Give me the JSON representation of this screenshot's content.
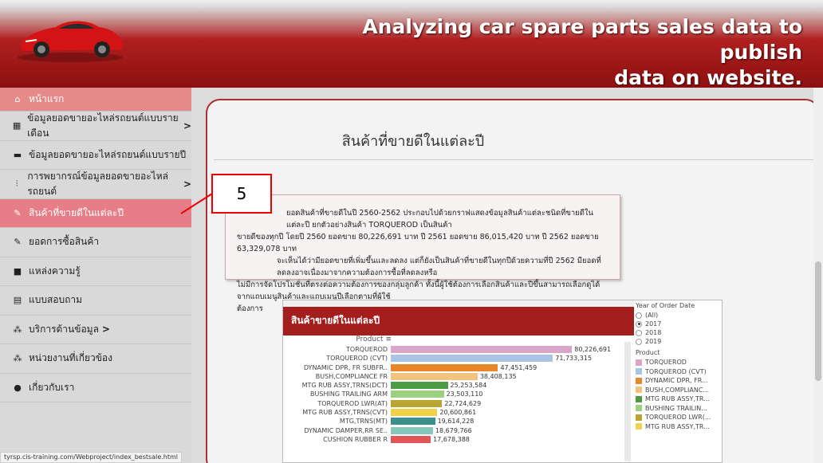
{
  "header": {
    "title_line1": "Analyzing car spare parts sales data to publish",
    "title_line2": "data on website."
  },
  "sidebar": {
    "items": [
      {
        "label": "หน้าแรก",
        "icon": "home-icon"
      },
      {
        "label": "ข้อมูลยอดขายอะไหล่รถยนต์แบบรายเดือน",
        "icon": "calendar-icon",
        "arrow": ">"
      },
      {
        "label": "ข้อมูลยอดขายอะไหล่รถยนต์แบบรายปี",
        "icon": "calendar-icon"
      },
      {
        "label": "การพยากรณ์ข้อมูลยอดขายอะไหล่รถยนต์",
        "icon": "chart-icon",
        "arrow": ">"
      },
      {
        "label": "สินค้าที่ขายดีในแต่ละปี",
        "icon": "wrench-icon"
      },
      {
        "label": "ยอดการซื้อสินค้า",
        "icon": "wrench-icon"
      },
      {
        "label": "แหล่งความรู้",
        "icon": "book-icon"
      },
      {
        "label": "แบบสอบถาม",
        "icon": "document-icon"
      },
      {
        "label": "บริการด้านข้อมูล",
        "icon": "sitemap-icon",
        "arrow": ">"
      },
      {
        "label": "หน่วยงานที่เกี่ยวข้อง",
        "icon": "sitemap-icon"
      },
      {
        "label": "เกี่ยวกับเรา",
        "icon": "user-icon"
      }
    ]
  },
  "main": {
    "title": "สินค้าที่ขายดีในแต่ละปี",
    "description_line1": "ยอดสินค้าที่ขายดีในปี 2560-2562 ประกอบไปด้วยกราฟแสดงข้อมูลสินค้าแต่ละชนิดที่ขายดีในแต่ละปี ยกตัวอย่างสินค้า TORQUEROD เป็นสินค้า",
    "description_line2": "ขายดีของทุกปี โดยปี 2560 ยอดขาย 80,226,691 บาท ปี 2561 ยอดขาย 86,015,420 บาท ปี 2562 ยอดขาย 63,329,078 บาท",
    "description_line3": "จะเห็นได้ว่ามียอดขายที่เพิ่มขึ้นและลดลง แต่ก็ยังเป็นสินค้าที่ขายดีในทุกปีด้วยความที่ปี 2562 มียอดที่ลดลงอาจเนื่องมาจากความต้องการซื้อที่ลดลงหรือ",
    "description_line4": "ไม่มีการจัดโปรโมชั่นที่ตรงต่อความต้องการของกลุ่มลูกค้า ทั้งนี้ผู้ใช้ต้องการเลือกสินค้าและปีขึ้นสามารถเลือกดูได้จากแถบเมนูสินค้าและแถบเมนูปีเลือกตามที่ผู้ใช้",
    "description_line5": "ต้องการ",
    "callout_number": "5"
  },
  "status_url": "tyrsp.cis-training.com/Webproject/index_bestsale.html",
  "filters": {
    "year_title": "Year of Order Date",
    "years": [
      "(All)",
      "2017",
      "2018",
      "2019"
    ],
    "selected_year": "2017",
    "product_title": "Product",
    "products": [
      {
        "name": "TORQUEROD",
        "color": "#d9a6c9"
      },
      {
        "name": "TORQUEROD (CVT)",
        "color": "#a9c3e6"
      },
      {
        "name": "DYNAMIC DPR, FR...",
        "color": "#e8862a"
      },
      {
        "name": "BUSH,COMPLIANC...",
        "color": "#f2c27f"
      },
      {
        "name": "MTG RUB ASSY,TR...",
        "color": "#4c9c46"
      },
      {
        "name": "BUSHING TRAILIN...",
        "color": "#9bd17e"
      },
      {
        "name": "TORQUEROD LWR(...",
        "color": "#b9a532"
      },
      {
        "name": "MTG RUB ASSY,TR...",
        "color": "#f0d14a"
      }
    ]
  },
  "chart_data": {
    "type": "bar",
    "title": "สินค้าขายดีในแต่ละปี",
    "dimension_label": "Product",
    "categories": [
      "TORQUEROD",
      "TORQUEROD (CVT)",
      "DYNAMIC DPR, FR SUBFR..",
      "BUSH,COMPLIANCE FR",
      "MTG RUB ASSY,TRNS(DCT)",
      "BUSHING TRAILING ARM",
      "TORQUEROD LWR(AT)",
      "MTG RUB ASSY,TRNS(CVT)",
      "MTG,TRNS(MT)",
      "DYNAMIC DAMPER,RR SE..",
      "CUSHION RUBBER R"
    ],
    "values": [
      80226691,
      71733315,
      47451459,
      38408135,
      25253584,
      23503110,
      22724629,
      20600861,
      19614228,
      18679766,
      17678388
    ],
    "value_labels": [
      "80,226,691",
      "71,733,315",
      "47,451,459",
      "38,408,135",
      "25,253,584",
      "23,503,110",
      "22,724,629",
      "20,600,861",
      "19,614,228",
      "18,679,766",
      "17,678,388"
    ],
    "colors": [
      "#d9a6c9",
      "#a9c3e6",
      "#e8862a",
      "#f2c27f",
      "#4c9c46",
      "#9bd17e",
      "#b9a532",
      "#f0d14a",
      "#3c8f8a",
      "#86c7b8",
      "#e15759"
    ],
    "xlim": [
      0,
      90000000
    ]
  }
}
